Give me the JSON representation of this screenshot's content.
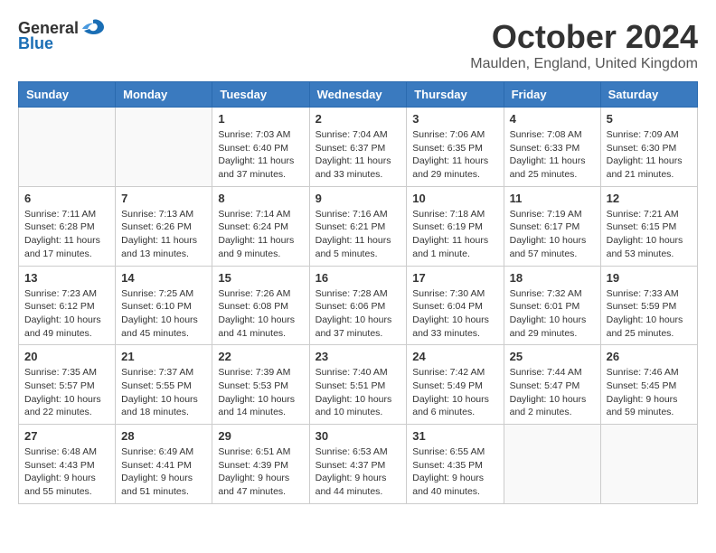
{
  "logo": {
    "general": "General",
    "blue": "Blue"
  },
  "header": {
    "month": "October 2024",
    "location": "Maulden, England, United Kingdom"
  },
  "weekdays": [
    "Sunday",
    "Monday",
    "Tuesday",
    "Wednesday",
    "Thursday",
    "Friday",
    "Saturday"
  ],
  "weeks": [
    [
      {
        "day": "",
        "info": ""
      },
      {
        "day": "",
        "info": ""
      },
      {
        "day": "1",
        "info": "Sunrise: 7:03 AM\nSunset: 6:40 PM\nDaylight: 11 hours and 37 minutes."
      },
      {
        "day": "2",
        "info": "Sunrise: 7:04 AM\nSunset: 6:37 PM\nDaylight: 11 hours and 33 minutes."
      },
      {
        "day": "3",
        "info": "Sunrise: 7:06 AM\nSunset: 6:35 PM\nDaylight: 11 hours and 29 minutes."
      },
      {
        "day": "4",
        "info": "Sunrise: 7:08 AM\nSunset: 6:33 PM\nDaylight: 11 hours and 25 minutes."
      },
      {
        "day": "5",
        "info": "Sunrise: 7:09 AM\nSunset: 6:30 PM\nDaylight: 11 hours and 21 minutes."
      }
    ],
    [
      {
        "day": "6",
        "info": "Sunrise: 7:11 AM\nSunset: 6:28 PM\nDaylight: 11 hours and 17 minutes."
      },
      {
        "day": "7",
        "info": "Sunrise: 7:13 AM\nSunset: 6:26 PM\nDaylight: 11 hours and 13 minutes."
      },
      {
        "day": "8",
        "info": "Sunrise: 7:14 AM\nSunset: 6:24 PM\nDaylight: 11 hours and 9 minutes."
      },
      {
        "day": "9",
        "info": "Sunrise: 7:16 AM\nSunset: 6:21 PM\nDaylight: 11 hours and 5 minutes."
      },
      {
        "day": "10",
        "info": "Sunrise: 7:18 AM\nSunset: 6:19 PM\nDaylight: 11 hours and 1 minute."
      },
      {
        "day": "11",
        "info": "Sunrise: 7:19 AM\nSunset: 6:17 PM\nDaylight: 10 hours and 57 minutes."
      },
      {
        "day": "12",
        "info": "Sunrise: 7:21 AM\nSunset: 6:15 PM\nDaylight: 10 hours and 53 minutes."
      }
    ],
    [
      {
        "day": "13",
        "info": "Sunrise: 7:23 AM\nSunset: 6:12 PM\nDaylight: 10 hours and 49 minutes."
      },
      {
        "day": "14",
        "info": "Sunrise: 7:25 AM\nSunset: 6:10 PM\nDaylight: 10 hours and 45 minutes."
      },
      {
        "day": "15",
        "info": "Sunrise: 7:26 AM\nSunset: 6:08 PM\nDaylight: 10 hours and 41 minutes."
      },
      {
        "day": "16",
        "info": "Sunrise: 7:28 AM\nSunset: 6:06 PM\nDaylight: 10 hours and 37 minutes."
      },
      {
        "day": "17",
        "info": "Sunrise: 7:30 AM\nSunset: 6:04 PM\nDaylight: 10 hours and 33 minutes."
      },
      {
        "day": "18",
        "info": "Sunrise: 7:32 AM\nSunset: 6:01 PM\nDaylight: 10 hours and 29 minutes."
      },
      {
        "day": "19",
        "info": "Sunrise: 7:33 AM\nSunset: 5:59 PM\nDaylight: 10 hours and 25 minutes."
      }
    ],
    [
      {
        "day": "20",
        "info": "Sunrise: 7:35 AM\nSunset: 5:57 PM\nDaylight: 10 hours and 22 minutes."
      },
      {
        "day": "21",
        "info": "Sunrise: 7:37 AM\nSunset: 5:55 PM\nDaylight: 10 hours and 18 minutes."
      },
      {
        "day": "22",
        "info": "Sunrise: 7:39 AM\nSunset: 5:53 PM\nDaylight: 10 hours and 14 minutes."
      },
      {
        "day": "23",
        "info": "Sunrise: 7:40 AM\nSunset: 5:51 PM\nDaylight: 10 hours and 10 minutes."
      },
      {
        "day": "24",
        "info": "Sunrise: 7:42 AM\nSunset: 5:49 PM\nDaylight: 10 hours and 6 minutes."
      },
      {
        "day": "25",
        "info": "Sunrise: 7:44 AM\nSunset: 5:47 PM\nDaylight: 10 hours and 2 minutes."
      },
      {
        "day": "26",
        "info": "Sunrise: 7:46 AM\nSunset: 5:45 PM\nDaylight: 9 hours and 59 minutes."
      }
    ],
    [
      {
        "day": "27",
        "info": "Sunrise: 6:48 AM\nSunset: 4:43 PM\nDaylight: 9 hours and 55 minutes."
      },
      {
        "day": "28",
        "info": "Sunrise: 6:49 AM\nSunset: 4:41 PM\nDaylight: 9 hours and 51 minutes."
      },
      {
        "day": "29",
        "info": "Sunrise: 6:51 AM\nSunset: 4:39 PM\nDaylight: 9 hours and 47 minutes."
      },
      {
        "day": "30",
        "info": "Sunrise: 6:53 AM\nSunset: 4:37 PM\nDaylight: 9 hours and 44 minutes."
      },
      {
        "day": "31",
        "info": "Sunrise: 6:55 AM\nSunset: 4:35 PM\nDaylight: 9 hours and 40 minutes."
      },
      {
        "day": "",
        "info": ""
      },
      {
        "day": "",
        "info": ""
      }
    ]
  ]
}
